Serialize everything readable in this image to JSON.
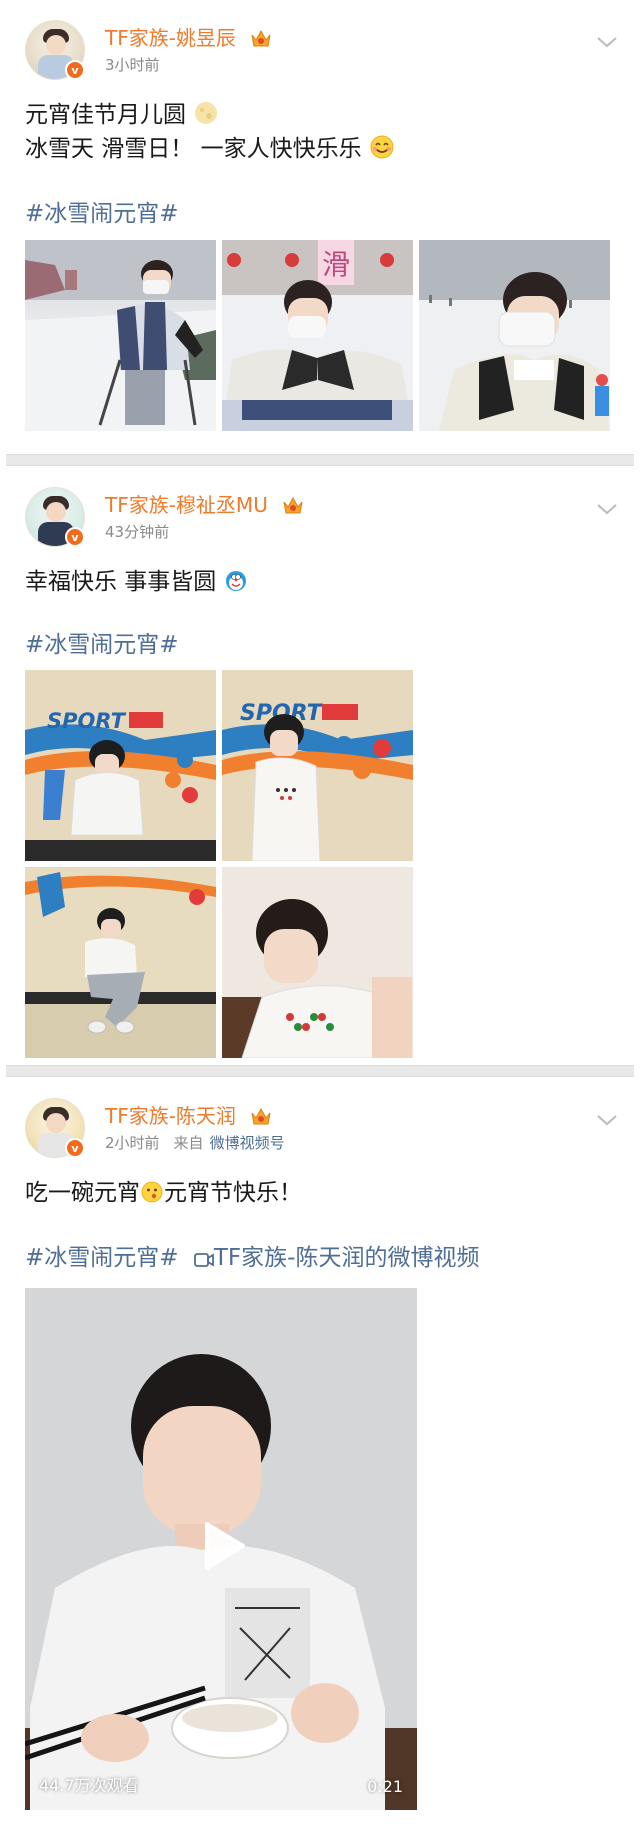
{
  "posts": [
    {
      "author": "TF家族-姚昱辰",
      "time": "3小时前",
      "lines": [
        "元宵佳节月儿圆",
        "冰雪天 滑雪日！ 一家人快快乐乐"
      ],
      "hashtag": "#冰雪闹元宵#"
    },
    {
      "author": "TF家族-穆祉丞MU",
      "time": "43分钟前",
      "lines": [
        "幸福快乐 事事皆圆"
      ],
      "hashtag": "#冰雪闹元宵#"
    },
    {
      "author": "TF家族-陈天润",
      "time": "2小时前",
      "from_label": "来自",
      "source": "微博视频号",
      "lines": [
        "吃一碗元宵",
        "元宵节快乐！"
      ],
      "hashtag": "#冰雪闹元宵#",
      "video_link": "TF家族-陈天润的微博视频",
      "video": {
        "views": "44.7万次观看",
        "duration": "0:21"
      }
    }
  ],
  "photo_text": {
    "sport": "SPORT",
    "slide": "滑"
  },
  "colors": {
    "accent_name": "#f07a2a",
    "link_blue": "#4e6e96",
    "badge_orange": "#f26b1d"
  },
  "icons": [
    "verified-badge-icon",
    "crown-icon",
    "chevron-down-icon",
    "moon-emoji-icon",
    "smile-emoji-icon",
    "doraemon-emoji-icon",
    "surprised-emoji-icon",
    "video-link-icon",
    "play-icon"
  ]
}
